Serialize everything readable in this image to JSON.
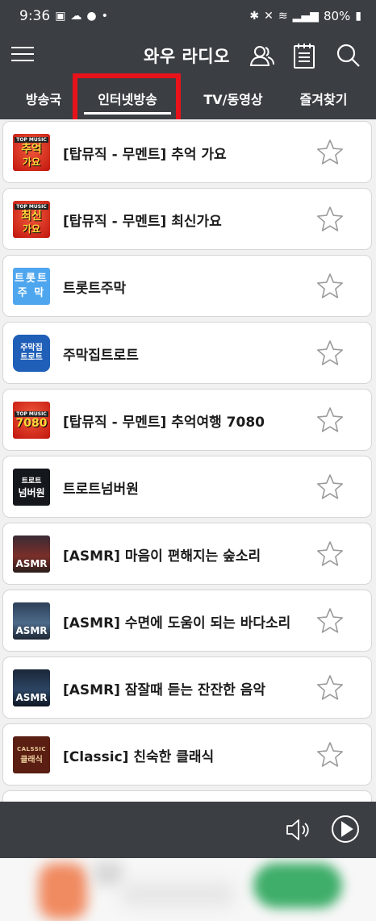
{
  "status_bar": {
    "time": "9:36",
    "battery": "80%"
  },
  "header": {
    "title": "와우 라디오"
  },
  "tabs": [
    {
      "label": "방송국",
      "selected": false
    },
    {
      "label": "인터넷방송",
      "selected": true
    },
    {
      "label": "TV/동영상",
      "selected": false
    },
    {
      "label": "즐겨찾기",
      "selected": false
    }
  ],
  "thumbs": {
    "top_music": "TOP MUSIC",
    "chueok": "추억",
    "gayo": "가요",
    "choesin": "최신",
    "trot_line1": "트롯트",
    "trot_line2": "주 막",
    "jumakjip_line1": "주막집",
    "jumakjip_line2": "트로트",
    "seventy_eighty": "7080",
    "trot": "트로트",
    "number_one": "넘버원",
    "asmr": "ASMR",
    "classic_en": "CALSSIC",
    "classic_ko": "클래식"
  },
  "stations": [
    {
      "title": "[탑뮤직 - 무멘트] 추억 가요",
      "favorite": false
    },
    {
      "title": "[탑뮤직 - 무멘트] 최신가요",
      "favorite": false
    },
    {
      "title": "트롯트주막",
      "favorite": false
    },
    {
      "title": "주막집트로트",
      "favorite": false
    },
    {
      "title": "[탑뮤직 - 무멘트] 추억여행 7080",
      "favorite": false
    },
    {
      "title": "트로트넘버원",
      "favorite": false
    },
    {
      "title": "[ASMR] 마음이 편해지는 숲소리",
      "favorite": false
    },
    {
      "title": "[ASMR] 수면에 도움이 되는 바다소리",
      "favorite": false
    },
    {
      "title": "[ASMR] 잠잘때 듣는 잔잔한 음악",
      "favorite": false
    },
    {
      "title": "[Classic] 친숙한 클래식",
      "favorite": false
    }
  ],
  "icons": {
    "menu": "hamburger-menu-icon",
    "user": "user-profile-icon",
    "schedule": "schedule-notepad-icon",
    "search": "search-icon",
    "star": "star-outline-icon",
    "volume": "volume-icon",
    "play": "play-circle-icon"
  },
  "colors": {
    "header_bg": "#3b3e43",
    "tab_highlight": "#e8131a",
    "list_bg": "#f1f1f1"
  }
}
